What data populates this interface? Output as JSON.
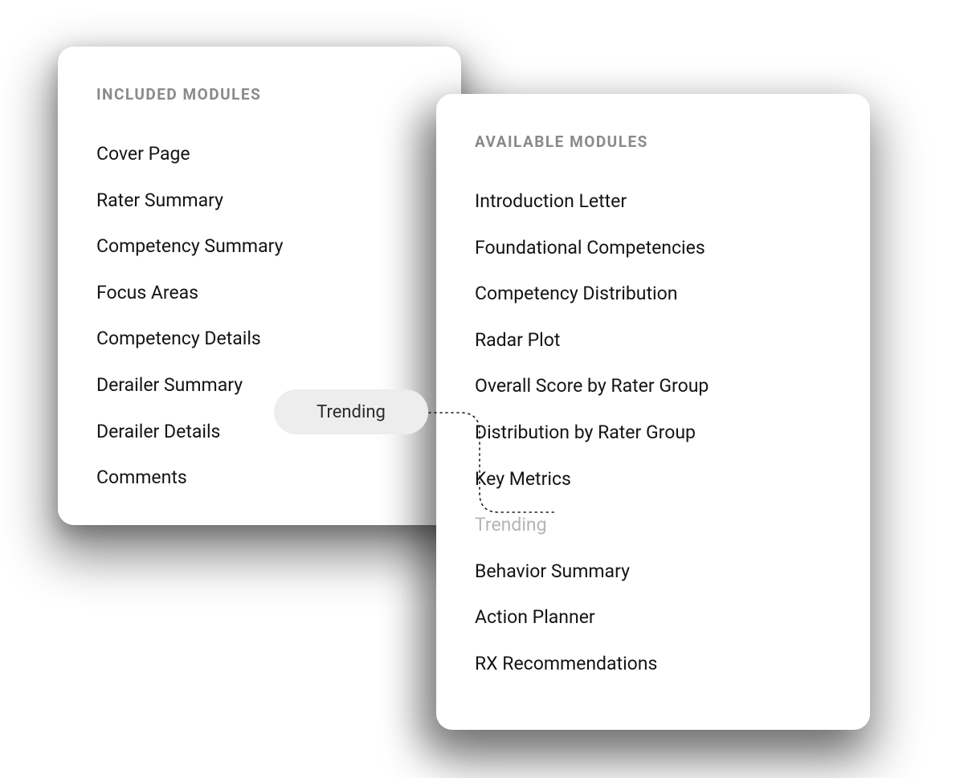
{
  "included": {
    "title": "INCLUDED MODULES",
    "items": [
      "Cover Page",
      "Rater Summary",
      "Competency Summary",
      "Focus Areas",
      "Competency Details",
      "Derailer Summary",
      "Derailer Details",
      "Comments"
    ]
  },
  "available": {
    "title": "AVAILABLE MODULES",
    "items": [
      {
        "label": "Introduction Letter",
        "ghost": false
      },
      {
        "label": "Foundational Competencies",
        "ghost": false
      },
      {
        "label": "Competency Distribution",
        "ghost": false
      },
      {
        "label": "Radar Plot",
        "ghost": false
      },
      {
        "label": "Overall Score by Rater Group",
        "ghost": false
      },
      {
        "label": "Distribution by Rater Group",
        "ghost": false
      },
      {
        "label": "Key Metrics",
        "ghost": false
      },
      {
        "label": "Trending",
        "ghost": true
      },
      {
        "label": "Behavior Summary",
        "ghost": false
      },
      {
        "label": "Action Planner",
        "ghost": false
      },
      {
        "label": "RX Recommendations",
        "ghost": false
      }
    ]
  },
  "drag": {
    "label": "Trending"
  }
}
